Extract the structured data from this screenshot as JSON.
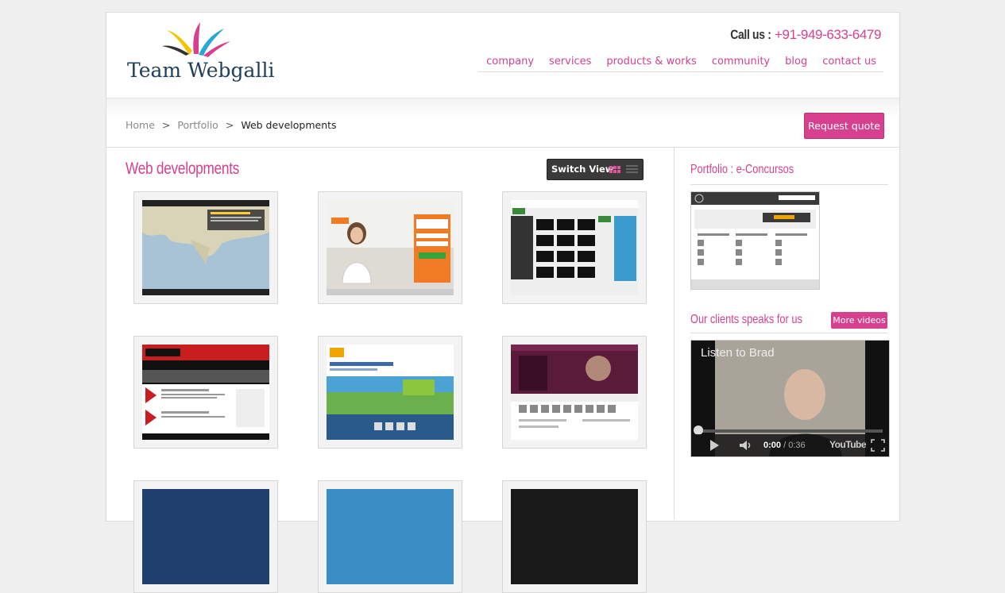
{
  "logo": {
    "text": "Team Webgalli"
  },
  "contact": {
    "label": "Call us :",
    "phone": "+91-949-633-6479"
  },
  "nav": [
    "company",
    "services",
    "products & works",
    "community",
    "blog",
    "contact us"
  ],
  "breadcrumb": {
    "home": "Home",
    "sep": ">",
    "portfolio": "Portfolio",
    "current": "Web developments"
  },
  "request_quote": "Request quote",
  "main": {
    "title": "Web developments",
    "switch_view": "Switch View"
  },
  "sidebar": {
    "portfolio_title": "Portfolio : e-Concursos",
    "clients_title": "Our clients speaks for us",
    "more_videos": "More videos",
    "video": {
      "title": "Listen to Brad",
      "time_current": "0:00",
      "time_total": "/ 0:36",
      "brand": "YouTube"
    }
  },
  "colors": {
    "accent": "#d6408e",
    "text_dark": "#222222",
    "background": "#efefef"
  }
}
